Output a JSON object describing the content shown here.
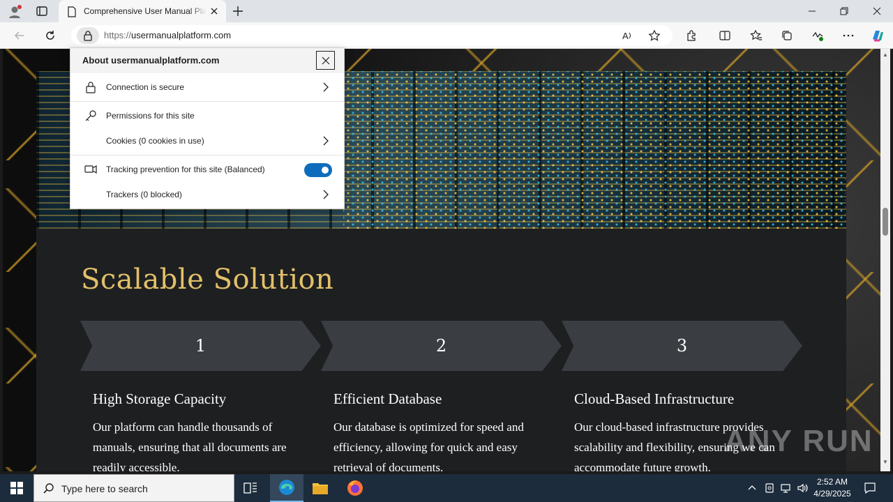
{
  "browser": {
    "tab_title": "Comprehensive User Manual Platform",
    "url_protocol": "https://",
    "url_host": "usermanualplatform.com"
  },
  "popup": {
    "title": "About usermanualplatform.com",
    "rows": [
      {
        "label": "Connection is secure"
      },
      {
        "label": "Permissions for this site"
      },
      {
        "label": "Cookies (0 cookies in use)"
      },
      {
        "label": "Tracking prevention for this site (Balanced)",
        "toggle_on": true
      },
      {
        "label": "Trackers (0 blocked)"
      }
    ]
  },
  "page": {
    "heading": "Scalable Solution",
    "steps": [
      "1",
      "2",
      "3"
    ],
    "cards": [
      {
        "title": "High Storage Capacity",
        "text": "Our platform can handle thousands of manuals, ensuring that all documents are readily accessible."
      },
      {
        "title": "Efficient Database",
        "text": "Our database is optimized for speed and efficiency, allowing for quick and easy retrieval of documents."
      },
      {
        "title": "Cloud-Based Infrastructure",
        "text": "Our cloud-based infrastructure provides scalability and flexibility, ensuring we can accommodate future growth."
      }
    ]
  },
  "taskbar": {
    "search_placeholder": "Type here to search",
    "time": "2:52 AM",
    "date": "4/29/2025"
  },
  "watermark": "ANY RUN",
  "colors": {
    "accent": "#0f6cbd",
    "heading_gold": "#e2c06a",
    "content_bg": "#1e1f21",
    "step_bg": "#3a3d42"
  }
}
